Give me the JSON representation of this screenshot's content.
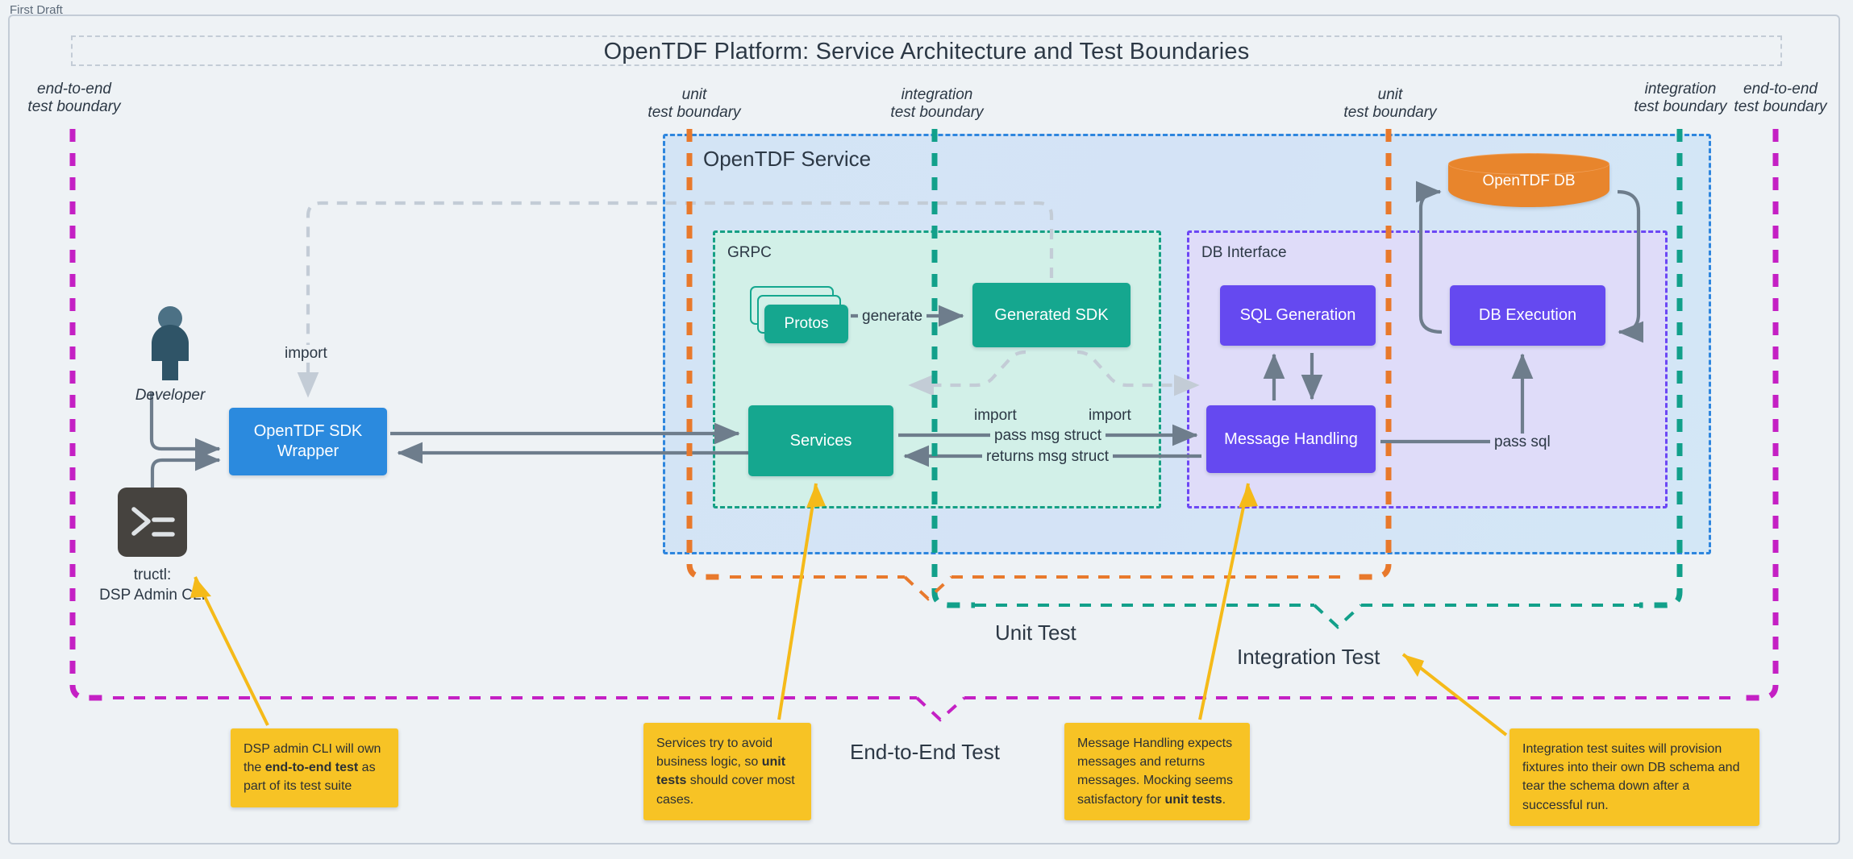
{
  "window": {
    "draft_label": "First Draft"
  },
  "title": "OpenTDF Platform: Service Architecture and Test Boundaries",
  "boundaries": [
    {
      "id": "e2e-left",
      "name": "end-to-end test boundary",
      "line1": "end-to-end",
      "line2": "test boundary",
      "color": "#c420c4"
    },
    {
      "id": "unit-left",
      "name": "unit test boundary",
      "line1": "unit",
      "line2": "test boundary",
      "color": "#e8792c"
    },
    {
      "id": "integ-left",
      "name": "integration test boundary",
      "line1": "integration",
      "line2": "test boundary",
      "color": "#12a08a"
    },
    {
      "id": "unit-right",
      "name": "unit test boundary",
      "line1": "unit",
      "line2": "test boundary",
      "color": "#e8792c"
    },
    {
      "id": "integ-right",
      "name": "integration test boundary",
      "line1": "integration",
      "line2": "test boundary",
      "color": "#12a08a"
    },
    {
      "id": "e2e-right",
      "name": "end-to-end test boundary",
      "line1": "end-to-end",
      "line2": "test boundary",
      "color": "#c420c4"
    }
  ],
  "containers": {
    "service": {
      "label": "OpenTDF Service",
      "border_color": "#2e86de",
      "fill": "#d6e5f6"
    },
    "grpc": {
      "label": "GRPC",
      "border_color": "#16a085",
      "fill": "#d2f0e8"
    },
    "db_interface": {
      "label": "DB Interface",
      "border_color": "#6c47f5",
      "fill": "#dfdcf9"
    }
  },
  "nodes": {
    "developer": {
      "label": "Developer",
      "icon": "user-icon"
    },
    "cli": {
      "label_line1": "tructl:",
      "label_line2": "DSP Admin CLI",
      "icon": "terminal-icon"
    },
    "sdk_wrapper": {
      "line1": "OpenTDF SDK",
      "line2": "Wrapper",
      "color": "#2b8ade"
    },
    "protos": {
      "label": "Protos",
      "color": "#15a78f"
    },
    "generated_sdk": {
      "label": "Generated SDK",
      "color": "#15a78f"
    },
    "services": {
      "label": "Services",
      "color": "#15a78f"
    },
    "sql_generation": {
      "label": "SQL Generation",
      "color": "#6549f0"
    },
    "db_execution": {
      "label": "DB Execution",
      "color": "#6549f0"
    },
    "message_handling": {
      "label": "Message Handling",
      "color": "#6549f0"
    },
    "opentdf_db": {
      "label": "OpenTDF DB",
      "color": "#e8852c",
      "shape": "cylinder"
    }
  },
  "edges": {
    "import_top": "import",
    "generate": "generate",
    "import_left": "import",
    "import_right": "import",
    "pass_msg": "pass msg struct",
    "returns_msg": "returns msg struct",
    "pass_sql": "pass sql"
  },
  "test_regions": [
    {
      "id": "unit-test",
      "label": "Unit Test",
      "color": "#e8792c"
    },
    {
      "id": "integration-test",
      "label": "Integration Test",
      "color": "#12a08a"
    },
    {
      "id": "end-to-end-test",
      "label": "End-to-End Test",
      "color": "#c420c4"
    }
  ],
  "notes": [
    {
      "id": "note-cli",
      "pre": "DSP admin CLI will own the ",
      "bold": "end-to-end test",
      "post": " as part of its test suite"
    },
    {
      "id": "note-services",
      "pre": "Services try to avoid business logic, so ",
      "bold": "unit tests",
      "post": " should cover most cases."
    },
    {
      "id": "note-msg",
      "pre": "Message Handling expects messages and returns messages. Mocking seems satisfactory for ",
      "bold": "unit tests",
      "post": "."
    },
    {
      "id": "note-integration",
      "pre": "Integration test suites will provision fixtures into their own DB schema and tear the schema down after a successful run.",
      "bold": "",
      "post": ""
    }
  ],
  "colors": {
    "canvas": "#eef2f5",
    "arrow_gray": "#6e7d8c",
    "arrow_dashed": "#c3ccd6",
    "note_yellow": "#f7c325",
    "leader_yellow": "#f5ba19"
  }
}
